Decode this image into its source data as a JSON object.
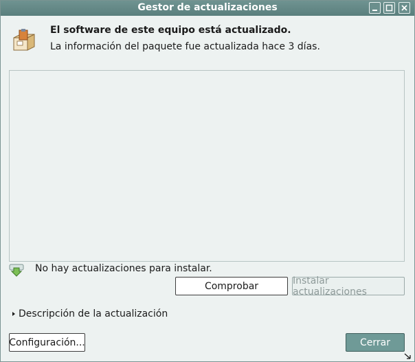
{
  "window": {
    "title": "Gestor de actualizaciones",
    "controls": {
      "minimize": "minimize-icon",
      "maximize": "maximize-icon",
      "close": "close-icon"
    }
  },
  "header": {
    "icon": "software-package-icon",
    "headline": "El software de este equipo está actualizado.",
    "subline": "La información del paquete fue actualizada hace 3 días."
  },
  "update_list": {
    "items": []
  },
  "status": {
    "icon": "download-arrow-icon",
    "text": "No hay actualizaciones para instalar."
  },
  "actions": {
    "check_label": "Comprobar",
    "install_label": "Instalar actualizaciones",
    "install_enabled": false
  },
  "details": {
    "expander_label": "Descripción de la actualización",
    "expanded": false
  },
  "footer": {
    "settings_label": "Configuración...",
    "close_label": "Cerrar"
  },
  "colors": {
    "titlebar": "#5f8583",
    "window_bg": "#edf2f1",
    "accent_button": "#6f9a97"
  }
}
